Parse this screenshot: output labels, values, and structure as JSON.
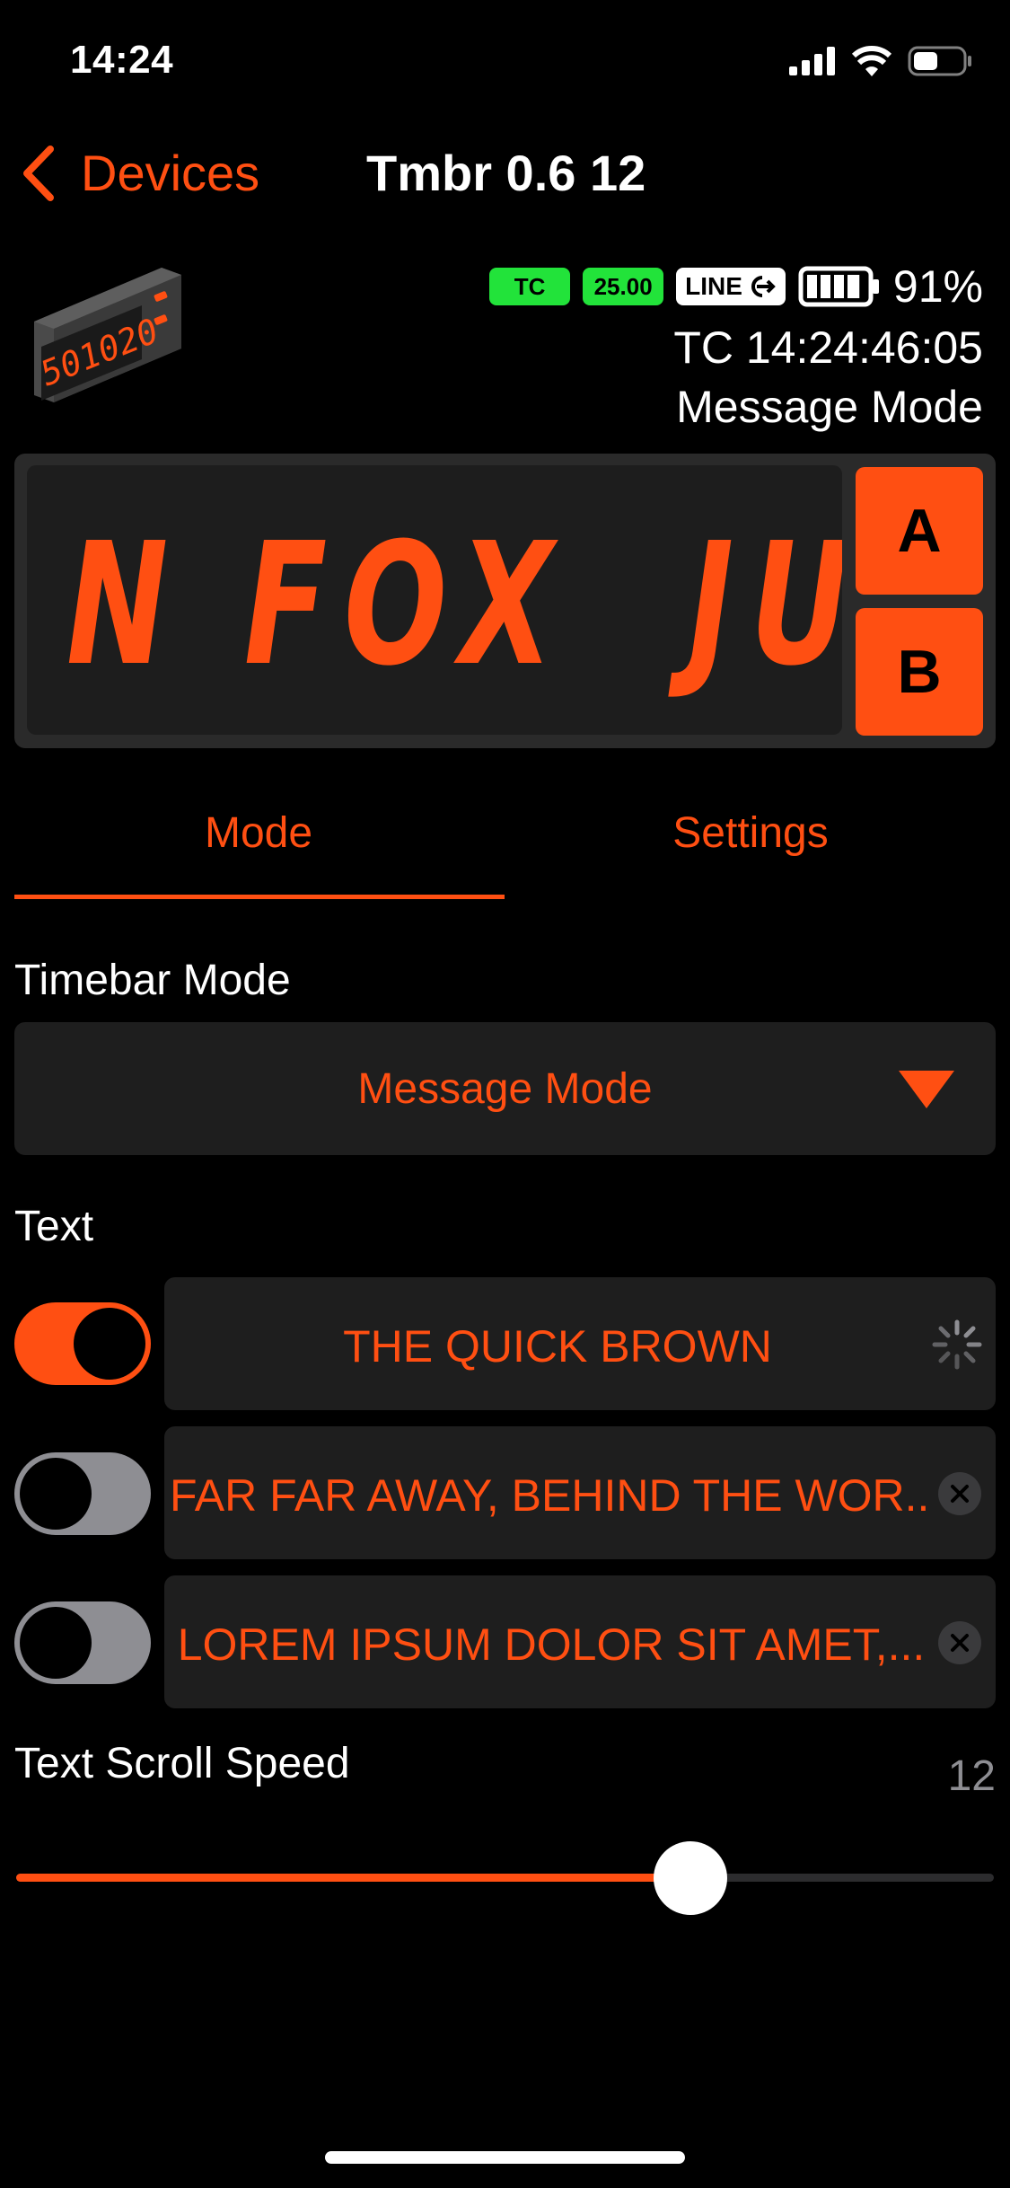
{
  "status_bar": {
    "time": "14:24",
    "icons": [
      "cellular-icon",
      "wifi-icon",
      "battery-icon"
    ]
  },
  "nav": {
    "back_label": "Devices",
    "title": "Tmbr 0.6 12"
  },
  "device": {
    "image_text": "501020",
    "badges": {
      "tc": "TC",
      "fps": "25.00",
      "line": "LINE"
    },
    "battery_pct": "91%",
    "battery_level": 0.91,
    "timecode": "TC 14:24:46:05",
    "mode": "Message Mode"
  },
  "display": {
    "text": "N FOX  JU",
    "button_a": "A",
    "button_b": "B"
  },
  "tabs": [
    {
      "label": "Mode",
      "active": true
    },
    {
      "label": "Settings",
      "active": false
    }
  ],
  "timebar_mode": {
    "label": "Timebar Mode",
    "value": "Message Mode"
  },
  "text_section": {
    "label": "Text",
    "rows": [
      {
        "enabled": true,
        "value": "THE QUICK BROWN",
        "trailing": "spinner-icon"
      },
      {
        "enabled": false,
        "value": "FAR FAR AWAY, BEHIND THE WOR...",
        "trailing": "clear-icon"
      },
      {
        "enabled": false,
        "value": "LOREM IPSUM DOLOR SIT AMET,...",
        "trailing": "clear-icon"
      }
    ]
  },
  "scroll_speed": {
    "label": "Text Scroll Speed",
    "value": "12",
    "fraction": 0.69
  },
  "colors": {
    "accent": "#ff4f12",
    "badge_green": "#22e33a",
    "background": "#000000",
    "field": "#1e1e1e"
  }
}
